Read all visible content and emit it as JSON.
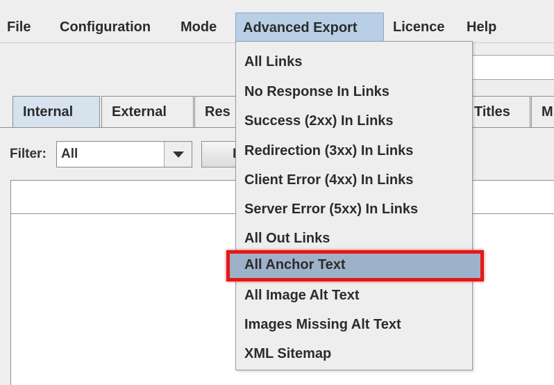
{
  "menubar": {
    "items": [
      "File",
      "Configuration",
      "Mode",
      "Advanced Export",
      "Licence",
      "Help"
    ]
  },
  "tabs": [
    "Internal",
    "External",
    "Res",
    "Titles",
    "M"
  ],
  "filter": {
    "label": "Filter:",
    "value": "All"
  },
  "export_button": {
    "label": "E"
  },
  "dropdown": {
    "items": [
      "All Links",
      "No Response In Links",
      "Success (2xx) In Links",
      "Redirection (3xx) In Links",
      "Client Error (4xx) In Links",
      "Server Error (5xx) In Links",
      "All Out Links",
      "All Anchor Text",
      "All Image Alt Text",
      "Images Missing Alt Text",
      "XML Sitemap"
    ],
    "highlighted_item": "All Anchor Text"
  },
  "colors": {
    "active_menu": "#b8cfe5",
    "highlight_fill": "#9db2c9",
    "highlight_border": "#e61717"
  }
}
